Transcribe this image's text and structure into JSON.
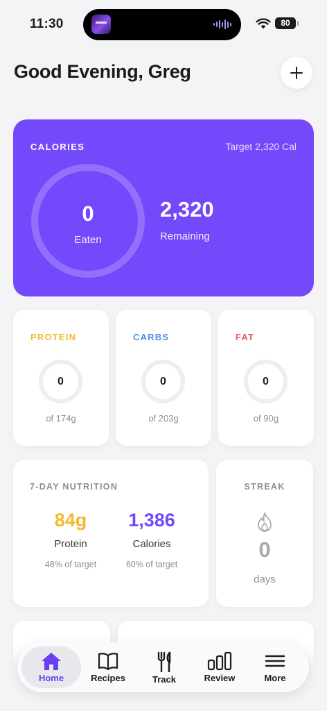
{
  "status_bar": {
    "time": "11:30",
    "battery": "80"
  },
  "header": {
    "greeting": "Good Evening, Greg"
  },
  "calories": {
    "title": "CALORIES",
    "target": "Target 2,320 Cal",
    "eaten_value": "0",
    "eaten_label": "Eaten",
    "remaining_value": "2,320",
    "remaining_label": "Remaining",
    "progress": 0
  },
  "macros": [
    {
      "label": "PROTEIN",
      "value": "0",
      "of": "of 174g",
      "color": "#f4b92d",
      "progress": 0
    },
    {
      "label": "CARBS",
      "value": "0",
      "of": "of 203g",
      "color": "#4f8fe8",
      "progress": 0
    },
    {
      "label": "FAT",
      "value": "0",
      "of": "of 90g",
      "color": "#ec5f5f",
      "progress": 0
    }
  ],
  "weekly": {
    "title": "7-DAY NUTRITION",
    "protein": {
      "value": "84g",
      "label": "Protein",
      "pct": "48% of target",
      "color": "#f4b92d"
    },
    "calories": {
      "value": "1,386",
      "label": "Calories",
      "pct": "60% of target",
      "color": "#7349fb"
    }
  },
  "streak": {
    "title": "STREAK",
    "value": "0",
    "label": "days",
    "icon": "flame-icon"
  },
  "tabs": [
    {
      "label": "Home",
      "icon": "home-icon",
      "active": true
    },
    {
      "label": "Recipes",
      "icon": "book-icon",
      "active": false
    },
    {
      "label": "Track",
      "icon": "utensils-icon",
      "active": false
    },
    {
      "label": "Review",
      "icon": "bar-chart-icon",
      "active": false
    },
    {
      "label": "More",
      "icon": "menu-icon",
      "active": false
    }
  ],
  "colors": {
    "accent": "#7349fb",
    "background": "#f4f4f6"
  }
}
